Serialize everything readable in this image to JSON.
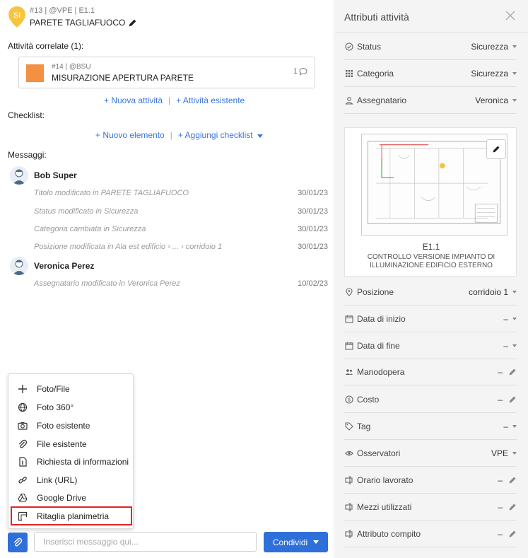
{
  "header": {
    "pin_initials": "SI",
    "meta": "#13 | @VPE | E1.1",
    "title": "PARETE TAGLIAFUOCO"
  },
  "related": {
    "label": "Attività correlate (1):",
    "card": {
      "meta": "#14 | @BSU",
      "title": "MISURAZIONE APERTURA PARETE",
      "count": "1",
      "color": "#f39041"
    },
    "new_link": "+ Nuova attività",
    "existing_link": "+ Attività esistente"
  },
  "checklist": {
    "label": "Checklist:",
    "new_link": "+ Nuovo elemento",
    "add_link": "+ Aggiungi checklist"
  },
  "messages": {
    "label": "Messaggi:",
    "groups": [
      {
        "user": "Bob Super",
        "lines": [
          {
            "text": "Titolo modificato in PARETE TAGLIAFUOCO",
            "date": "30/01/23"
          },
          {
            "text": "Status modificato in Sicurezza",
            "date": "30/01/23"
          },
          {
            "text": "Categoria cambiata in Sicurezza",
            "date": "30/01/23"
          },
          {
            "text": "Posizione modificata in Ala est edificio › ... › corridoio 1",
            "date": "30/01/23"
          }
        ]
      },
      {
        "user": "Veronica Perez",
        "lines": [
          {
            "text": "Assegnatario modificato in Veronica Perez",
            "date": "10/02/23"
          }
        ]
      }
    ]
  },
  "attach_menu": {
    "items": [
      {
        "label": "Foto/File",
        "icon": "plus-icon"
      },
      {
        "label": "Foto 360°",
        "icon": "globe-icon"
      },
      {
        "label": "Foto esistente",
        "icon": "camera-icon"
      },
      {
        "label": "File esistente",
        "icon": "paperclip-icon"
      },
      {
        "label": "Richiesta di informazioni",
        "icon": "document-info-icon"
      },
      {
        "label": "Link (URL)",
        "icon": "link-icon"
      },
      {
        "label": "Google Drive",
        "icon": "google-drive-icon"
      },
      {
        "label": "Ritaglia planimetria",
        "icon": "crop-plan-icon"
      }
    ],
    "highlighted": "Ritaglia planimetria"
  },
  "composer": {
    "placeholder": "Inserisci messaggio qui...",
    "share_label": "Condividi"
  },
  "panel": {
    "title": "Attributi attività",
    "top_attrs": [
      {
        "label": "Status",
        "value": "Sicurezza",
        "icon": "status-icon"
      },
      {
        "label": "Categoria",
        "value": "Sicurezza",
        "icon": "grid-icon"
      },
      {
        "label": "Assegnatario",
        "value": "Veronica",
        "icon": "person-icon"
      }
    ],
    "plan": {
      "code": "E1.1",
      "description": "CONTROLLO VERSIONE IMPIANTO DI ILLUMINAZIONE EDIFICIO ESTERNO"
    },
    "attrs": [
      {
        "label": "Posizione",
        "value": "corridoio 1",
        "icon": "location-icon",
        "control": "caret"
      },
      {
        "label": "Data di inizio",
        "value": "–",
        "icon": "calendar-icon",
        "control": "caret"
      },
      {
        "label": "Data di fine",
        "value": "–",
        "icon": "calendar-icon",
        "control": "caret"
      },
      {
        "label": "Manodopera",
        "value": "–",
        "icon": "people-icon",
        "control": "pen"
      },
      {
        "label": "Costo",
        "value": "–",
        "icon": "dollar-icon",
        "control": "pen"
      },
      {
        "label": "Tag",
        "value": "–",
        "icon": "tag-icon",
        "control": "caret"
      },
      {
        "label": "Osservatori",
        "value": "VPE",
        "icon": "eye-icon",
        "control": "caret"
      },
      {
        "label": "Orario lavorato",
        "value": "–",
        "icon": "custom-field-icon",
        "control": "pen"
      },
      {
        "label": "Mezzi utilizzati",
        "value": "–",
        "icon": "custom-field-icon",
        "control": "pen"
      },
      {
        "label": "Attributo compito",
        "value": "–",
        "icon": "custom-field-icon",
        "control": "pen"
      }
    ]
  },
  "colors": {
    "accent": "#2f6fd9",
    "link": "#3a74d8",
    "pin": "#f5c542",
    "highlight": "#e02424"
  }
}
